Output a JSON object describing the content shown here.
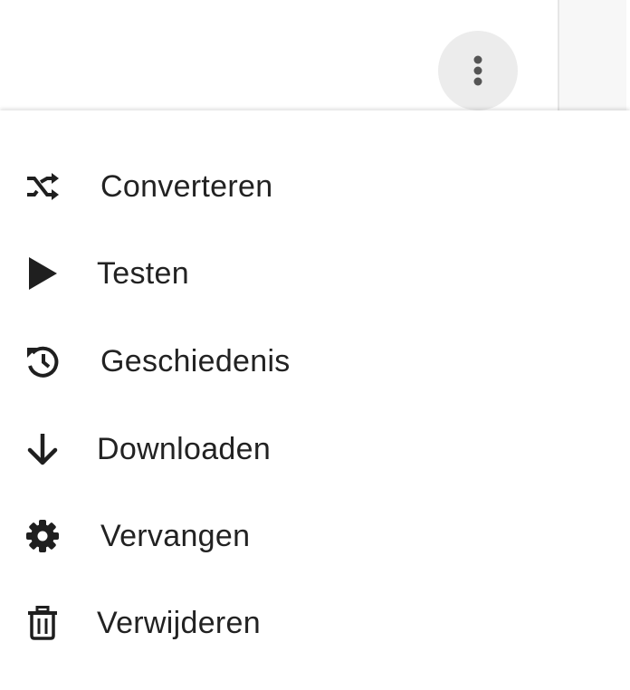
{
  "toolbar": {
    "more_icon": "more-vert-icon"
  },
  "menu": {
    "items": [
      {
        "label": "Converteren",
        "icon": "shuffle-icon"
      },
      {
        "label": "Testen",
        "icon": "play-icon"
      },
      {
        "label": "Geschiedenis",
        "icon": "history-icon"
      },
      {
        "label": "Downloaden",
        "icon": "arrow-down-icon"
      },
      {
        "label": "Vervangen",
        "icon": "gear-icon"
      },
      {
        "label": "Verwijderen",
        "icon": "trash-icon"
      }
    ]
  },
  "colors": {
    "text": "#222222",
    "icon": "#1f1f1f",
    "button_bg": "#ececec"
  }
}
